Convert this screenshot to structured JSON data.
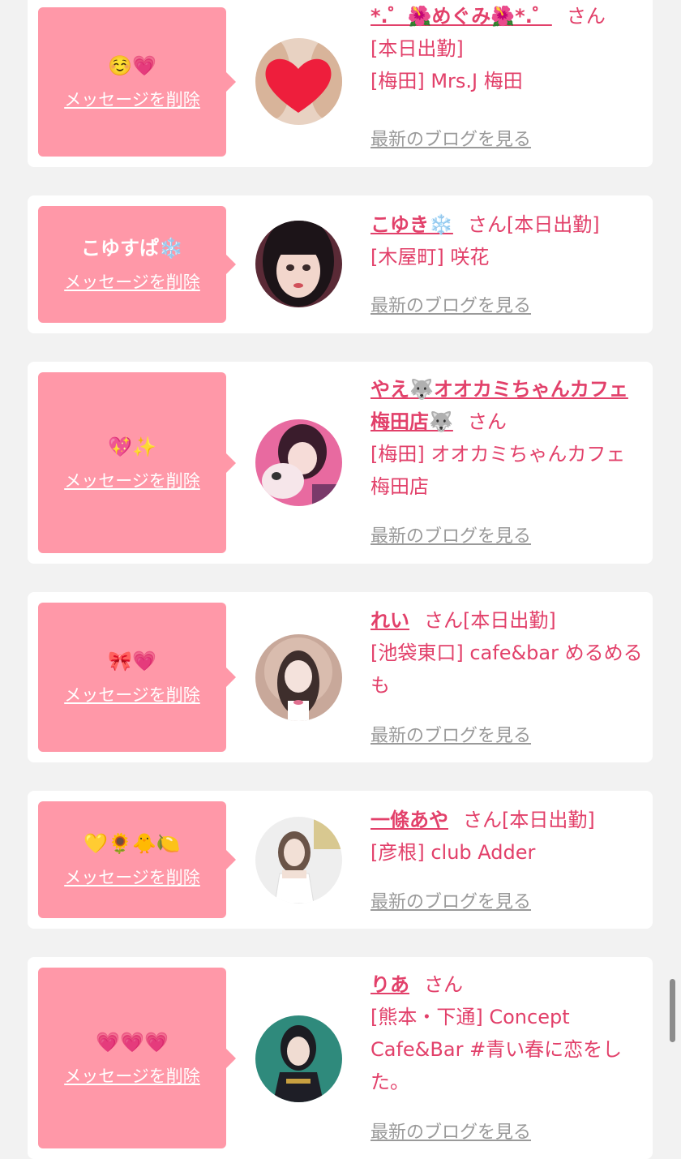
{
  "items": [
    {
      "message": "☺️💗",
      "delete_label": "メッセージを削除",
      "name": "*.゜🌺めぐみ🌺*.゜",
      "san": "さん",
      "details": "[本日出勤]\n[梅田] Mrs.J 梅田",
      "blog_label": "最新のブログを見る",
      "avatar_colors": [
        "#e8d2c2",
        "#b78a6a",
        "#ee1e3c"
      ]
    },
    {
      "message": "こゆすぱ❄️",
      "delete_label": "メッセージを削除",
      "name": "こゆき❄️",
      "san": "さん",
      "details": "[本日出勤]\n[木屋町] 咲花",
      "blog_label": "最新のブログを見る",
      "avatar_colors": [
        "#5a2a36",
        "#1c1418",
        "#f2d6cc"
      ]
    },
    {
      "message": "💖✨",
      "delete_label": "メッセージを削除",
      "name": "やえ🐺オオカミちゃんカフェ梅田店🐺",
      "san": "さん",
      "details": "[梅田] オオカミちゃんカフェ梅田店",
      "blog_label": "最新のブログを見る",
      "avatar_colors": [
        "#e86aa0",
        "#3a1c2c",
        "#f6e6ea"
      ]
    },
    {
      "message": "🎀💗",
      "delete_label": "メッセージを削除",
      "name": "れい",
      "san": "さん",
      "details": "[本日出勤]\n[池袋東口] cafe&bar めるめるも",
      "blog_label": "最新のブログを見る",
      "avatar_colors": [
        "#c8a89a",
        "#3e2e2c",
        "#f4e2dc"
      ]
    },
    {
      "message": "💛🌻🐥🍋",
      "delete_label": "メッセージを削除",
      "name": "一條あや",
      "san": "さん",
      "details": "[本日出勤]\n[彦根] club Adder",
      "blog_label": "最新のブログを見る",
      "avatar_colors": [
        "#eeeeee",
        "#6a5448",
        "#f2e0d6"
      ]
    },
    {
      "message": "💗💗💗",
      "delete_label": "メッセージを削除",
      "name": "りあ",
      "san": "さん",
      "details": "[熊本・下通] Concept Cafe&Bar #青い春に恋をした。",
      "blog_label": "最新のブログを見る",
      "avatar_colors": [
        "#2f8a7c",
        "#1c1c22",
        "#f0dcd2"
      ]
    }
  ]
}
